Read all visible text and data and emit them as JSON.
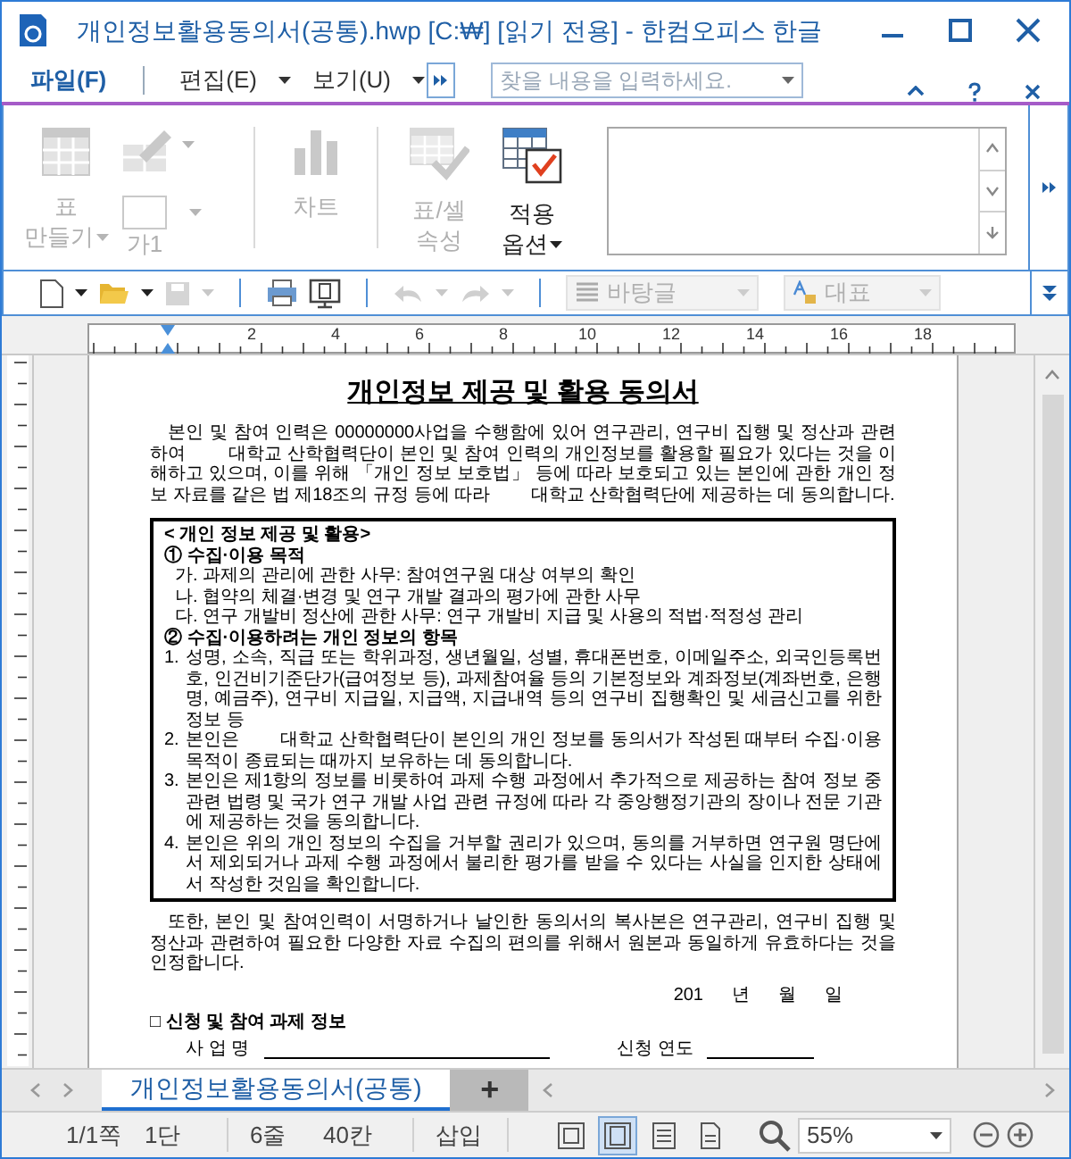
{
  "window": {
    "title": "개인정보활용동의서(공통).hwp [C:₩] [읽기 전용] - 한컴오피스 한글"
  },
  "menu": [
    {
      "label": "파일(F)",
      "kind": "file"
    },
    {
      "label": "편집(E)",
      "kind": "dropdown"
    },
    {
      "label": "보기(U)",
      "kind": "dropdown"
    }
  ],
  "search": {
    "placeholder": "찾을 내용을 입력하세요."
  },
  "ribbon": [
    {
      "kind": "table",
      "lines": [
        "표",
        "만들기"
      ],
      "disabled": true
    },
    {
      "kind": "pen",
      "disabled": true
    },
    {
      "kind": "box",
      "lines": [
        "가1"
      ],
      "disabled": true
    },
    {
      "kind": "chart",
      "lines": [
        "차트"
      ],
      "disabled": true
    },
    {
      "kind": "cellprops",
      "lines": [
        "표/셀",
        "속성"
      ],
      "disabled": true
    },
    {
      "kind": "apply",
      "lines": [
        "적용",
        "옵션"
      ],
      "disabled": false
    }
  ],
  "toolbar": [
    {
      "kind": "new",
      "disabled": false
    },
    {
      "kind": "open",
      "disabled": false
    },
    {
      "kind": "save",
      "disabled": true
    },
    {
      "kind": "print",
      "disabled": false
    },
    {
      "kind": "preview",
      "disabled": false
    },
    {
      "kind": "undo",
      "disabled": true
    },
    {
      "kind": "redo",
      "disabled": true
    },
    {
      "kind": "para-style",
      "value": "바탕글",
      "disabled": true
    },
    {
      "kind": "char-style",
      "value": "대표",
      "disabled": true
    }
  ],
  "ruler": {
    "numbers": [
      "2",
      "4",
      "6",
      "8",
      "10",
      "12",
      "14",
      "16",
      "18"
    ]
  },
  "document": {
    "title": "개인정보 제공 및 활용 동의서",
    "intro": "본인 및 참여 인력은 00000000사업을 수행함에 있어 연구관리, 연구비 집행 및 정산과 관련하여 　　대학교 산학협력단이 본인 및 참여 인력의 개인정보를 활용할 필요가 있다는 것을 이해하고 있으며, 이를 위해 「개인 정보 보호법」 등에 따라 보호되고 있는 본인에 관한 개인 정보 자료를 같은 법 제18조의 규정 등에 따라 　　대학교 산학협력단에 제공하는 데 동의합니다.",
    "box": [
      {
        "kind": "heading",
        "text": "< 개인 정보 제공 및 활용>"
      },
      {
        "kind": "section",
        "text": "① 수집·이용 목적"
      },
      {
        "kind": "sub",
        "text": "가. 과제의 관리에 관한 사무: 참여연구원 대상 여부의 확인"
      },
      {
        "kind": "sub",
        "text": "나. 협약의 체결·변경 및 연구 개발 결과의 평가에 관한 사무"
      },
      {
        "kind": "sub",
        "text": "다. 연구 개발비 정산에 관한 사무: 연구 개발비 지급 및 사용의 적법·적정성 관리"
      },
      {
        "kind": "section",
        "text": "② 수집·이용하려는 개인 정보의 항목"
      },
      {
        "kind": "numbered",
        "num": "1.",
        "text": "성명, 소속, 직급 또는 학위과정, 생년월일, 성별, 휴대폰번호, 이메일주소, 외국인등록번호, 인건비기준단가(급여정보 등), 과제참여율 등의 기본정보와 계좌정보(계좌번호, 은행명, 예금주), 연구비 지급일, 지급액, 지급내역 등의 연구비 집행확인 및 세금신고를 위한 정보 등"
      },
      {
        "kind": "numbered",
        "num": "2.",
        "text": "본인은 　　대학교 산학협력단이 본인의 개인 정보를 동의서가 작성된 때부터 수집·이용 목적이 종료되는 때까지 보유하는 데 동의합니다."
      },
      {
        "kind": "numbered",
        "num": "3.",
        "text": "본인은 제1항의 정보를 비롯하여 과제 수행 과정에서 추가적으로 제공하는 참여 정보 중 관련 법령 및 국가 연구 개발 사업 관련 규정에 따라 각 중앙행정기관의 장이나 전문 기관에 제공하는 것을 동의합니다."
      },
      {
        "kind": "numbered",
        "num": "4.",
        "text": "본인은 위의 개인 정보의 수집을 거부할 권리가 있으며, 동의를 거부하면 연구원 명단에서 제외되거나 과제 수행 과정에서 불리한 평가를 받을 수 있다는 사실을 인지한 상태에서 작성한 것임을 확인합니다."
      }
    ],
    "closing": "또한, 본인 및 참여인력이 서명하거나 날인한 동의서의 복사본은 연구관리, 연구비 집행 및 정산과 관련하여 필요한 다양한 자료 수집의 편의를 위해서 원본과 동일하게 유효하다는 것을 인정합니다.",
    "date": [
      "201",
      "년",
      "월",
      "일"
    ],
    "section": "□ 신청 및 참여 과제 정보",
    "fields": [
      {
        "label": "사 업 명"
      },
      {
        "label": "신청 연도"
      }
    ]
  },
  "tabs": [
    {
      "label": "개인정보활용동의서(공통)",
      "selected": true
    }
  ],
  "add_tab": "+",
  "status_bar": {
    "items": [
      "1/1쪽",
      "1단",
      "6줄",
      "40칸",
      "삽입"
    ],
    "views": [
      {
        "selected": false
      },
      {
        "selected": true
      },
      {
        "selected": false
      },
      {
        "selected": false
      }
    ],
    "zoom": "55%"
  }
}
